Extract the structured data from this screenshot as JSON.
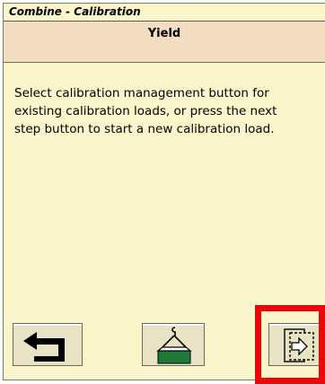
{
  "header": {
    "title": "Combine - Calibration"
  },
  "screen": {
    "subtitle": "Yield",
    "instructions": "Select calibration management button for existing calibration loads, or press the next step button to start a new calibration load."
  },
  "buttons": {
    "back": {
      "icon": "back-arrow-icon"
    },
    "calibration_management": {
      "icon": "hanging-load-icon",
      "accent": "#1f7a3a"
    },
    "next_step": {
      "icon": "next-step-icon"
    }
  },
  "highlight": {
    "color": "#e8080a",
    "target": "next-step-button"
  }
}
